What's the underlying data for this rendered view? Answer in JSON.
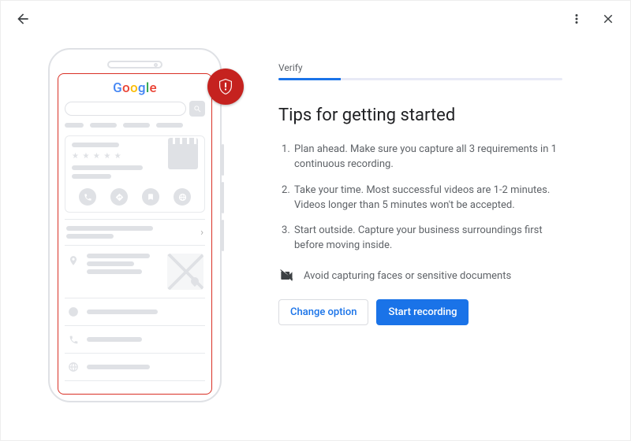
{
  "step": {
    "label": "Verify",
    "progress_percent": 22
  },
  "title": "Tips for getting started",
  "tips": [
    "Plan ahead. Make sure you capture all 3 requirements in 1 continuous recording.",
    "Take your time. Most successful videos are 1-2 minutes. Videos longer than 5 minutes won't be accepted.",
    "Start outside. Capture your business surroundings first before moving inside."
  ],
  "warning": "Avoid capturing faces or sensitive documents",
  "actions": {
    "change_option": "Change option",
    "start_recording": "Start recording"
  },
  "illustration": {
    "logo_text": "Google",
    "badge_icon": "shield-alert"
  },
  "colors": {
    "primary": "#1a73e8",
    "danger": "#c5221f"
  }
}
